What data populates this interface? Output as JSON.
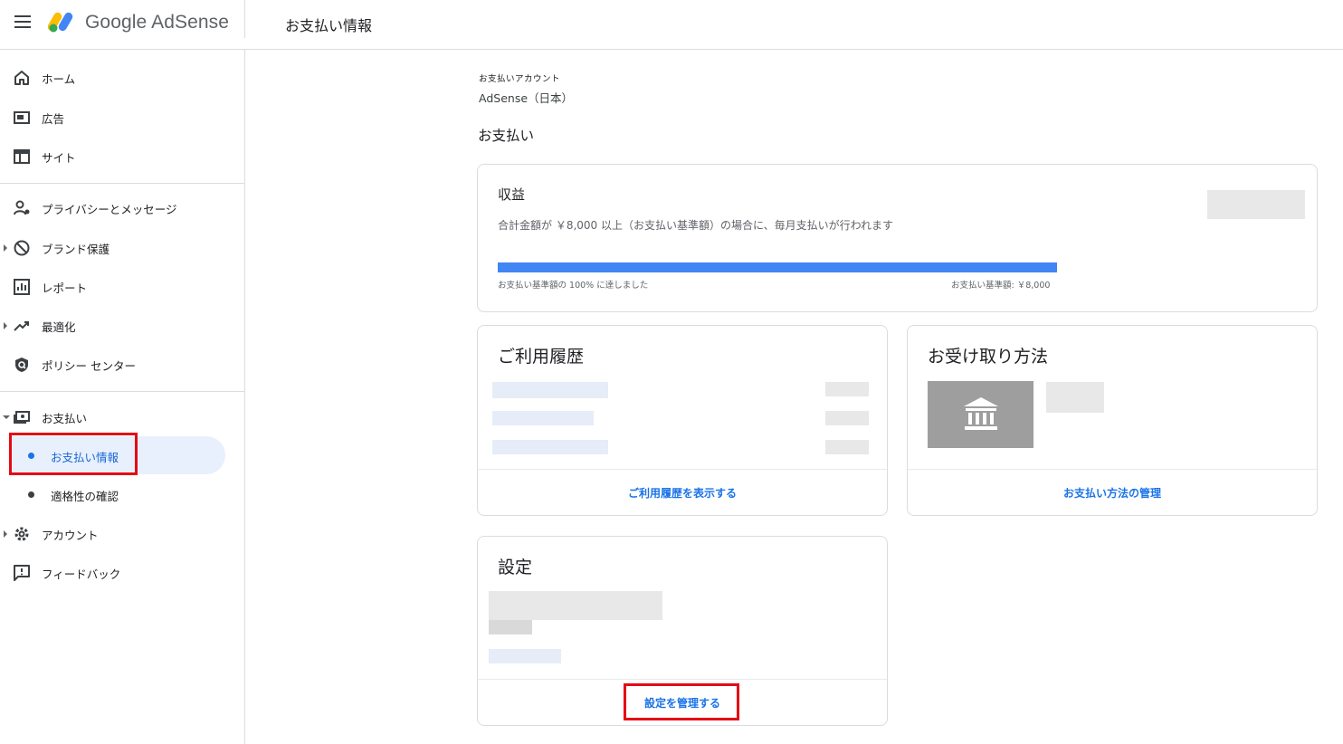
{
  "header": {
    "product_name": "Google AdSense",
    "page_title": "お支払い情報"
  },
  "sidebar": {
    "items": [
      {
        "label": "ホーム"
      },
      {
        "label": "広告"
      },
      {
        "label": "サイト"
      },
      {
        "label": "プライバシーとメッセージ"
      },
      {
        "label": "ブランド保護"
      },
      {
        "label": "レポート"
      },
      {
        "label": "最適化"
      },
      {
        "label": "ポリシー センター"
      },
      {
        "label": "お支払い"
      },
      {
        "label": "アカウント"
      },
      {
        "label": "フィードバック"
      }
    ],
    "payments_sub": [
      {
        "label": "お支払い情報",
        "active": true
      },
      {
        "label": "適格性の確認",
        "active": false
      }
    ]
  },
  "main": {
    "account_caption": "お支払いアカウント",
    "account_name": "AdSense（日本）",
    "section_title": "お支払い",
    "earnings": {
      "title": "収益",
      "description": "合計金額が ￥8,000 以上（お支払い基準額）の場合に、毎月支払いが行われます",
      "progress_label": "お支払い基準額の 100% に達しました",
      "threshold_label": "お支払い基準額: ￥8,000",
      "progress": 1.0
    },
    "history": {
      "title": "ご利用履歴",
      "link": "ご利用履歴を表示する"
    },
    "receive": {
      "title": "お受け取り方法",
      "link": "お支払い方法の管理"
    },
    "settings": {
      "title": "設定",
      "link": "設定を管理する"
    }
  },
  "colors": {
    "accent": "#1a73e8",
    "progress": "#4285f4",
    "highlight": "#e50914"
  }
}
